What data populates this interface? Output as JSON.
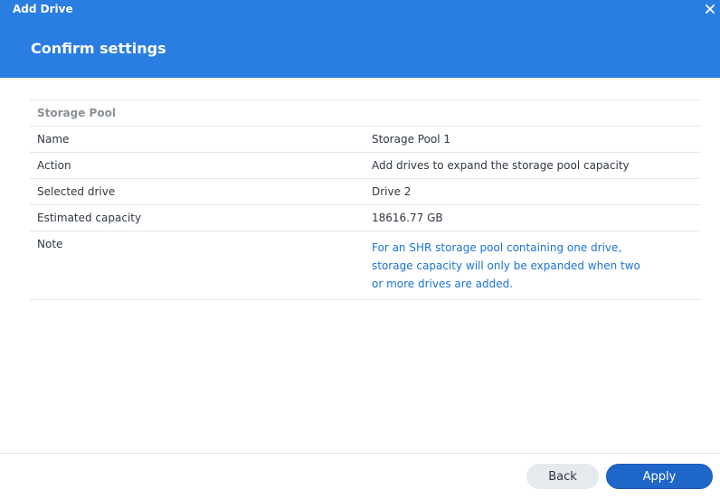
{
  "window": {
    "title": "Add Drive",
    "close_icon": "close-icon"
  },
  "step": {
    "title": "Confirm settings"
  },
  "summary": {
    "section_title": "Storage Pool",
    "rows": [
      {
        "label": "Name",
        "value": "Storage Pool 1"
      },
      {
        "label": "Action",
        "value": "Add drives to expand the storage pool capacity"
      },
      {
        "label": "Selected drive",
        "value": "Drive 2"
      },
      {
        "label": "Estimated capacity",
        "value": "18616.77 GB"
      }
    ],
    "note": {
      "label": "Note",
      "lines": [
        "For an SHR storage pool containing one drive,",
        "storage capacity will only be expanded when two",
        "or more drives are added."
      ]
    }
  },
  "footer": {
    "back_label": "Back",
    "apply_label": "Apply"
  },
  "colors": {
    "header": "#2a7de1",
    "note_text": "#1b73d6",
    "apply_button": "#1f66c9",
    "back_button": "#e6eaee"
  }
}
